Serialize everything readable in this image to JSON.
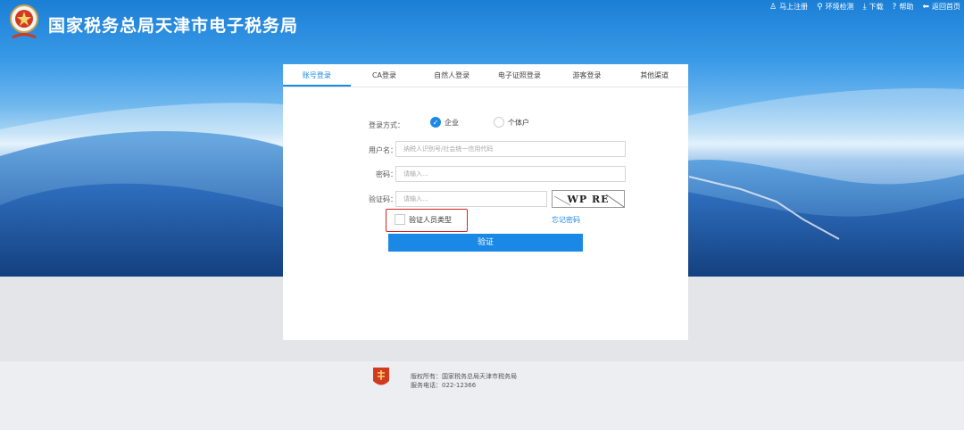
{
  "header": {
    "site_title": "国家税务总局天津市电子税务局",
    "links": [
      {
        "icon": "user-icon",
        "glyph": "♙",
        "label": "马上注册"
      },
      {
        "icon": "wrench-icon",
        "glyph": "⚲",
        "label": "环境检测"
      },
      {
        "icon": "download-icon",
        "glyph": "⤓",
        "label": "下载"
      },
      {
        "icon": "help-icon",
        "glyph": "?",
        "label": "帮助"
      },
      {
        "icon": "back-icon",
        "glyph": "⬅",
        "label": "返回首页"
      }
    ]
  },
  "tabs": [
    "账号登录",
    "CA登录",
    "自然人登录",
    "电子证照登录",
    "游客登录",
    "其他渠道"
  ],
  "active_tab": 0,
  "form": {
    "login_mode_label": "登录方式：",
    "mode_options": [
      {
        "label": "企业",
        "checked": true
      },
      {
        "label": "个体户",
        "checked": false
      }
    ],
    "username_label": "用户名：",
    "username_placeholder": "纳税人识别号/社会统一信用代码",
    "password_label": "密码：",
    "password_placeholder": "请输入...",
    "captcha_label": "验证码：",
    "captcha_placeholder": "请输入...",
    "captcha_text": "WP RE",
    "verify_type_label": "验证人员类型",
    "verify_type_checked": false,
    "forgot_label": "忘记密码",
    "submit_label": "验证"
  },
  "footer": {
    "copyright": "版权所有：国家税务总局天津市税务局",
    "phone": "服务电话：022-12366"
  },
  "colors": {
    "accent": "#1a88e5",
    "highlight": "#e02020",
    "emblem": "#d13a1f"
  }
}
